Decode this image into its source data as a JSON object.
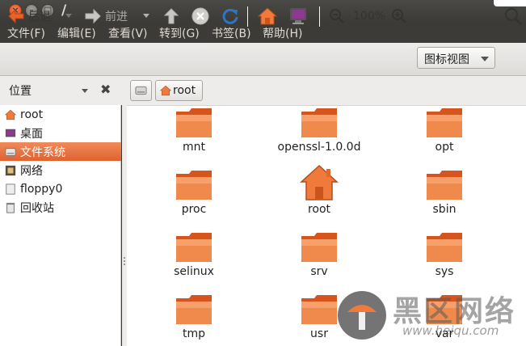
{
  "window": {
    "title": "/"
  },
  "menubar": {
    "items": [
      "文件(F)",
      "编辑(E)",
      "查看(V)",
      "转到(G)",
      "书签(B)",
      "帮助(H)"
    ]
  },
  "toolbar": {
    "back_label": "后退",
    "forward_label": "前进",
    "zoom_value": "100%",
    "view_mode": "图标视图"
  },
  "sidebar": {
    "title": "位置",
    "items": [
      {
        "label": "root",
        "icon": "home-icon"
      },
      {
        "label": "桌面",
        "icon": "desktop-icon"
      },
      {
        "label": "文件系统",
        "icon": "drive-icon",
        "selected": true
      },
      {
        "label": "网络",
        "icon": "network-icon"
      },
      {
        "label": "floppy0",
        "icon": "floppy-icon"
      },
      {
        "label": "回收站",
        "icon": "trash-icon"
      }
    ]
  },
  "location": {
    "crumbs": [
      "root"
    ]
  },
  "files": [
    {
      "name": "mnt",
      "icon": "folder-icon"
    },
    {
      "name": "openssl-1.0.0d",
      "icon": "folder-icon"
    },
    {
      "name": "opt",
      "icon": "folder-icon"
    },
    {
      "name": "proc",
      "icon": "folder-icon"
    },
    {
      "name": "root",
      "icon": "home-folder-icon"
    },
    {
      "name": "sbin",
      "icon": "folder-icon"
    },
    {
      "name": "selinux",
      "icon": "folder-icon"
    },
    {
      "name": "srv",
      "icon": "folder-icon"
    },
    {
      "name": "sys",
      "icon": "folder-icon"
    },
    {
      "name": "tmp",
      "icon": "folder-icon"
    },
    {
      "name": "usr",
      "icon": "folder-icon"
    },
    {
      "name": "var",
      "icon": "folder-icon"
    }
  ],
  "watermark": {
    "text": "黑区网络",
    "sub": "www.heiqu.com"
  },
  "colors": {
    "accent": "#e0622f",
    "folder": "#f07a3c",
    "chrome_dark": "#3c3b37"
  }
}
